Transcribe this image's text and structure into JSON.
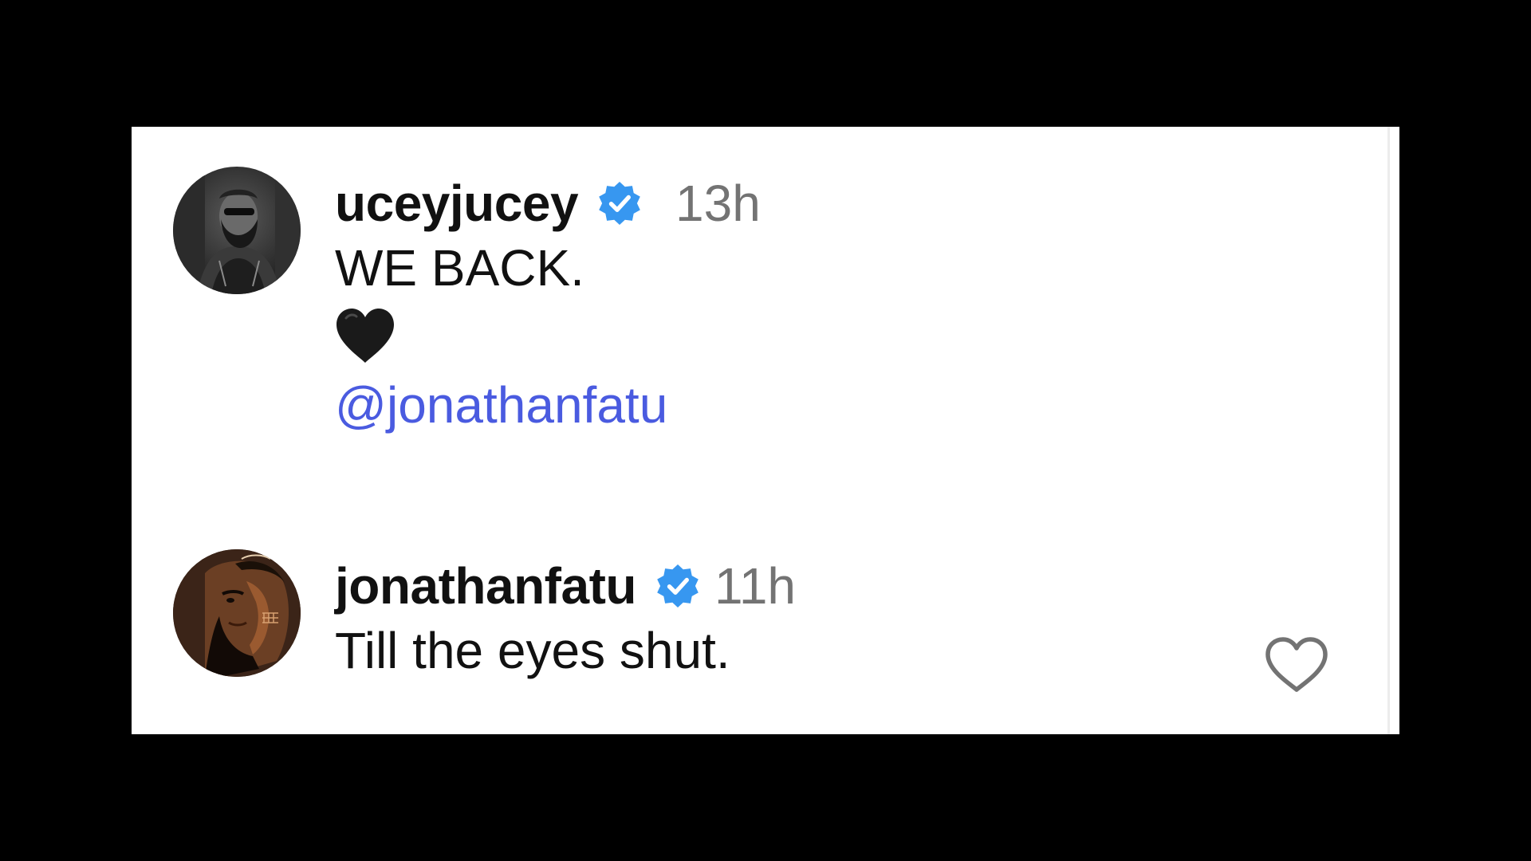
{
  "comments": [
    {
      "username": "uceyjucey",
      "verified": true,
      "timestamp": "13h",
      "lines": [
        "WE BACK."
      ],
      "emoji": "black-heart",
      "mention": "@jonathanfatu",
      "avatar": "photo-avatar"
    },
    {
      "username": "jonathanfatu",
      "verified": true,
      "timestamp": "11h",
      "lines": [
        "Till the eyes shut."
      ],
      "avatar": "illustrated-avatar",
      "like_icon": "heart-outline-icon"
    }
  ],
  "colors": {
    "background": "#000000",
    "card": "#ffffff",
    "verified_badge": "#3797f0",
    "mention": "#4a5be0",
    "timestamp": "#737373",
    "text": "#111111"
  }
}
